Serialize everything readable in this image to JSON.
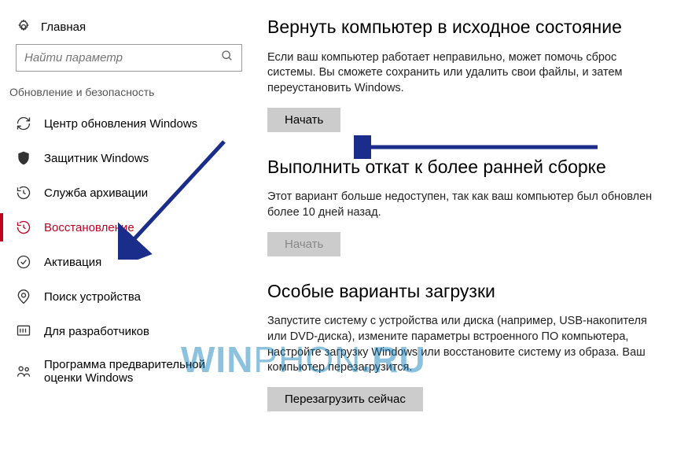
{
  "home_label": "Главная",
  "search_placeholder": "Найти параметр",
  "section_header": "Обновление и безопасность",
  "nav": [
    {
      "label": "Центр обновления Windows"
    },
    {
      "label": "Защитник Windows"
    },
    {
      "label": "Служба архивации"
    },
    {
      "label": "Восстановление"
    },
    {
      "label": "Активация"
    },
    {
      "label": "Поиск устройства"
    },
    {
      "label": "Для разработчиков"
    },
    {
      "label": "Программа предварительной оценки Windows"
    }
  ],
  "sections": {
    "reset": {
      "title": "Вернуть компьютер в исходное состояние",
      "desc": "Если ваш компьютер работает неправильно, может помочь сброс системы. Вы сможете сохранить или удалить свои файлы, и затем переустановить Windows.",
      "button": "Начать"
    },
    "rollback": {
      "title": "Выполнить откат к более ранней сборке",
      "desc": "Этот вариант больше недоступен, так как ваш компьютер был обновлен более 10 дней назад.",
      "button": "Начать"
    },
    "advanced": {
      "title": "Особые варианты загрузки",
      "desc": "Запустите систему с устройства или диска (например, USB-накопителя или DVD-диска), измените параметры встроенного ПО компьютера, настройте загрузку Windows или восстановите систему из образа. Ваш компьютер перезагрузится.",
      "button": "Перезагрузить сейчас"
    }
  },
  "watermark": "WINPHON.RU"
}
